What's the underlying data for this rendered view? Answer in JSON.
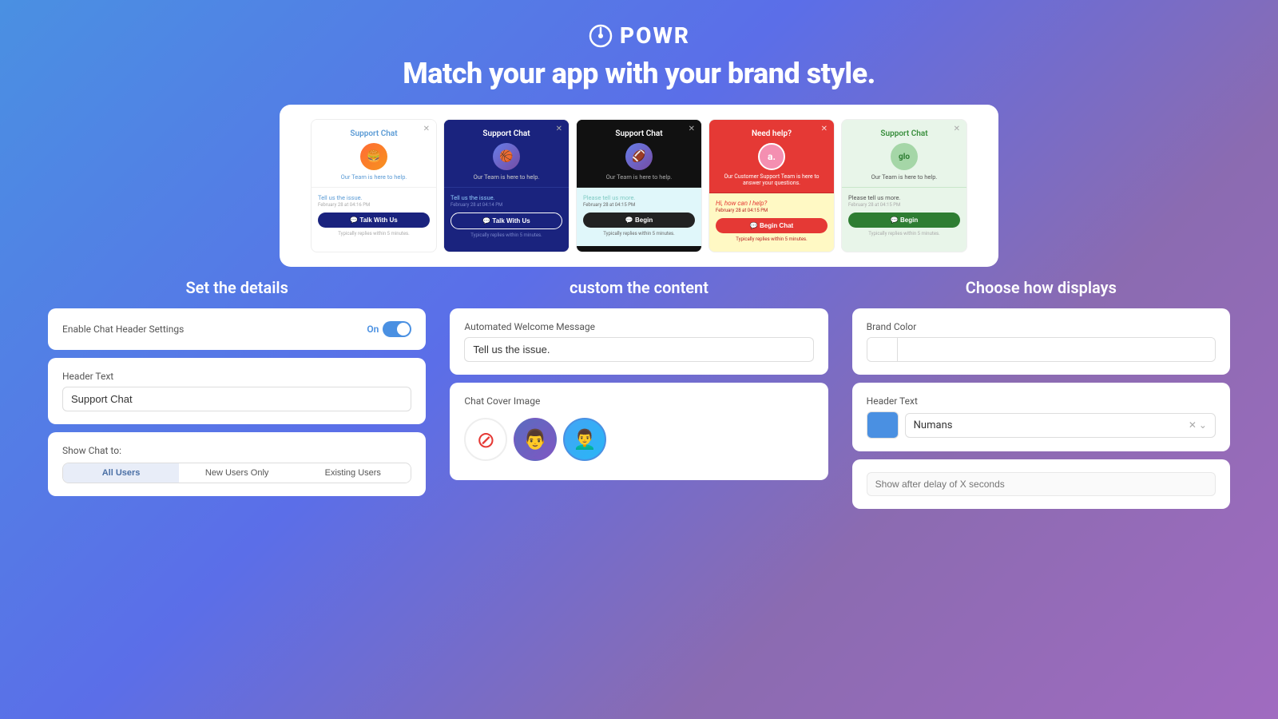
{
  "header": {
    "logo_icon": "⏻",
    "logo_name": "POWR",
    "headline": "Match your app with your brand style."
  },
  "preview": {
    "cards": [
      {
        "id": "card-1",
        "theme": "white",
        "title": "Support Chat",
        "avatar_emoji": "🍔",
        "subtitle": "Our Team is here to help.",
        "message": "Tell us the issue.",
        "time": "February 28 at 04:16 PM",
        "button": "Talk With Us",
        "footer": "Typically replies within 5 minutes."
      },
      {
        "id": "card-2",
        "theme": "dark-blue",
        "title": "Support Chat",
        "avatar_emoji": "🏀",
        "subtitle": "Our Team is here to help.",
        "message": "Tell us the issue.",
        "time": "February 28 at 04:14 PM",
        "button": "Talk With Us",
        "footer": "Typically replies within 5 minutes."
      },
      {
        "id": "card-3",
        "theme": "black-teal",
        "title": "Support Chat",
        "avatar_emoji": "🏈",
        "subtitle": "Our Team is here to help.",
        "message": "Please tell us more.",
        "time": "February 28 at 04:15 PM",
        "button": "Begin",
        "footer": "Typically replies within 5 minutes."
      },
      {
        "id": "card-4",
        "theme": "red",
        "title": "Need help?",
        "avatar_emoji": "A",
        "subtitle": "Our Customer Support Team is here to answer your questions.",
        "message": "Hi, how can I help?",
        "time": "February 28 at 04:15 PM",
        "button": "Begin Chat",
        "footer": "Typically replies within 5 minutes."
      },
      {
        "id": "card-5",
        "theme": "green",
        "title": "Support Chat",
        "avatar_emoji": "glo",
        "subtitle": "Our Team is here to help.",
        "message": "Please tell us more.",
        "time": "February 28 at 04:15 PM",
        "button": "Begin",
        "footer": "Typically replies within 5 minutes."
      }
    ]
  },
  "sections": {
    "left": {
      "title": "Set the details",
      "enable_label": "Enable Chat Header Settings",
      "toggle_state": "On",
      "header_text_label": "Header Text",
      "header_text_value": "Support Chat",
      "show_chat_label": "Show Chat to:",
      "radio_options": [
        "All Users",
        "New Users Only",
        "Existing Users"
      ]
    },
    "middle": {
      "title": "custom the content",
      "welcome_label": "Automated Welcome Message",
      "welcome_value": "Tell us the issue.",
      "cover_label": "Chat Cover Image"
    },
    "right": {
      "title": "Choose how displays",
      "brand_color_label": "Brand Color",
      "brand_color_value": "",
      "header_text_label": "Header Text",
      "header_font_color": "#4a90e2",
      "header_font_value": "Numans",
      "delay_label": "Show after delay of X seconds",
      "delay_placeholder": "Show after delay of X seconds"
    }
  }
}
